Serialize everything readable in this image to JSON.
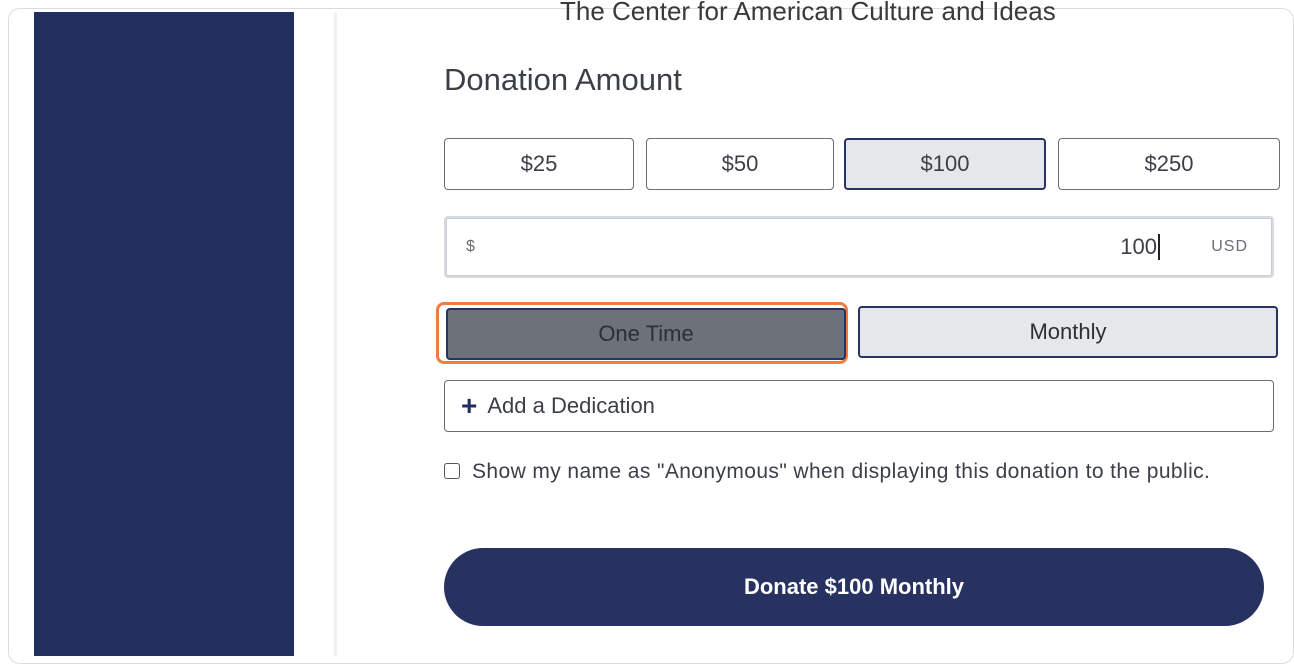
{
  "organization": {
    "name": "The Center for American Culture and Ideas"
  },
  "donation": {
    "title": "Donation Amount",
    "amounts": [
      "$25",
      "$50",
      "$100",
      "$250"
    ],
    "selected_amount": "$100",
    "input": {
      "currency_symbol": "$",
      "value": "100",
      "currency_code": "USD"
    },
    "frequency": {
      "one_time_label": "One Time",
      "monthly_label": "Monthly"
    },
    "dedication_label": "Add a Dedication",
    "anonymous_label": "Show my name as \"Anonymous\" when displaying this donation to the public.",
    "anonymous_checked": false,
    "submit_label": "Donate $100 Monthly"
  },
  "colors": {
    "sidebar": "#212f5f",
    "primary": "#283260",
    "focus_outline": "#ee7d42",
    "selected_bg": "#e6e7eb",
    "one_time_bg": "#6c717a"
  },
  "icons": {
    "dedication": "plus-icon"
  }
}
